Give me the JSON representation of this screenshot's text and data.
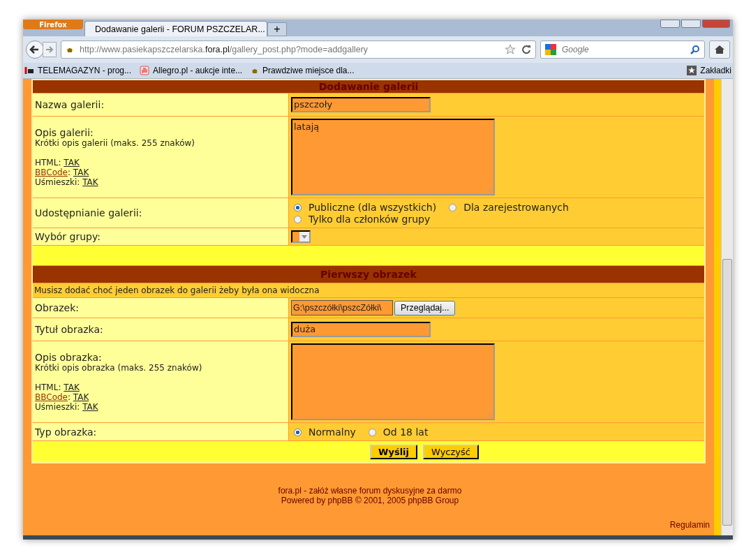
{
  "browser": {
    "menu_button": "Firefox",
    "tab_title": "Dodawanie galerii - FORUM PSZCZELAR...",
    "new_tab": "+",
    "url": {
      "prefix": "http://www.pasiekapszczelarska.",
      "host": "fora.pl",
      "path": "/gallery_post.php?mode=addgallery"
    },
    "search": {
      "placeholder": "Google"
    },
    "bookmarks": [
      {
        "label": "TELEMAGAZYN - prog..."
      },
      {
        "label": "Allegro.pl - aukcje inte..."
      },
      {
        "label": "Prawdziwe miejsce dla..."
      }
    ],
    "bookmarks_menu": "Zakładki"
  },
  "form": [
    {
      "kind": "header",
      "title": "Dodawanie galerii"
    },
    {
      "kind": "text",
      "label": "Nazwa galerii:",
      "value": "pszczoły"
    },
    {
      "kind": "textarea",
      "label": "Opis galerii:",
      "hint": "Krótki opis galerii (maks. 255 znaków)",
      "value": "latają",
      "help": [
        {
          "name": "HTML",
          "name_link": false,
          "sep": ":",
          "value": "TAK"
        },
        {
          "name": "BBCode",
          "name_link": true,
          "sep": ":",
          "value": "TAK"
        },
        {
          "name": "Uśmieszki",
          "name_link": false,
          "sep": ":",
          "value": "TAK"
        }
      ]
    },
    {
      "kind": "radio",
      "label": "Udostępnianie galerii:",
      "options": [
        {
          "label": "Publiczne (dla wszystkich)",
          "selected": true
        },
        {
          "label": "Dla zarejestrowanych",
          "selected": false
        },
        {
          "label": "Tylko dla członków grupy",
          "selected": false
        }
      ]
    },
    {
      "kind": "select",
      "label": "Wybór grupy:"
    },
    {
      "kind": "spacer"
    },
    {
      "kind": "header",
      "title": "Pierwszy obrazek"
    },
    {
      "kind": "note",
      "text": "Musisz dodać choć jeden obrazek do galerii żeby była ona widoczna"
    },
    {
      "kind": "file",
      "label": "Obrazek:",
      "value": "G:\\pszczółki\\pszcZółki\\",
      "button": "Przeglądaj..."
    },
    {
      "kind": "text",
      "label": "Tytuł obrazka:",
      "value": "duża"
    },
    {
      "kind": "textarea",
      "label": "Opis obrazka:",
      "hint": "Krótki opis obrazka (maks. 255 znaków)",
      "help": [
        {
          "name": "HTML",
          "name_link": false,
          "sep": ":",
          "value": "TAK"
        },
        {
          "name": "BBCode",
          "name_link": true,
          "sep": ":",
          "value": "TAK"
        },
        {
          "name": "Uśmieszki",
          "name_link": false,
          "sep": ":",
          "value": "TAK"
        }
      ]
    },
    {
      "kind": "radio",
      "label": "Typ obrazka:",
      "options": [
        {
          "label": "Normalny",
          "selected": true
        },
        {
          "label": "Od 18 lat",
          "selected": false
        }
      ]
    },
    {
      "kind": "buttons",
      "buttons": [
        {
          "label": "Wyślij",
          "primary": true
        },
        {
          "label": "Wyczyść",
          "primary": false
        }
      ]
    }
  ],
  "footer": {
    "lines": [
      "fora.pl - załóż własne forum dyskusyjne za darmo",
      "Powered by phpBB © 2001, 2005 phpBB Group"
    ],
    "rules_link": "Regulamin"
  }
}
